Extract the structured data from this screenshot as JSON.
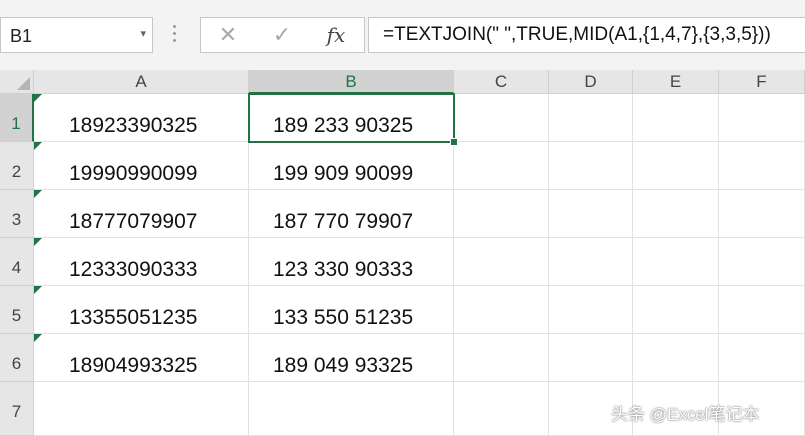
{
  "formula_bar": {
    "name_box": "B1",
    "name_box_dropdown": "▾",
    "cancel_icon": "✕",
    "enter_icon": "✓",
    "fx_icon": "fx",
    "formula": "=TEXTJOIN(\" \",TRUE,MID(A1,{1,4,7},{3,3,5}))"
  },
  "selected": {
    "column": "B",
    "row": "1"
  },
  "columns": [
    "A",
    "B",
    "C",
    "D",
    "E",
    "F"
  ],
  "rows": [
    {
      "num": "1",
      "a": "18923390325",
      "b": "189 233 90325"
    },
    {
      "num": "2",
      "a": "19990990099",
      "b": "199 909 90099"
    },
    {
      "num": "3",
      "a": "18777079907",
      "b": "187 770 79907"
    },
    {
      "num": "4",
      "a": "12333090333",
      "b": "123 330 90333"
    },
    {
      "num": "5",
      "a": "13355051235",
      "b": "133 550 51235"
    },
    {
      "num": "6",
      "a": "18904993325",
      "b": "189 049 93325"
    },
    {
      "num": "7",
      "a": "",
      "b": ""
    }
  ],
  "watermark": "头条 @Excel笔记本",
  "colors": {
    "accent": "#217346",
    "header_bg": "#e6e6e6",
    "selected_header_bg": "#d2d2d2",
    "gridline": "#e1e1e1"
  }
}
